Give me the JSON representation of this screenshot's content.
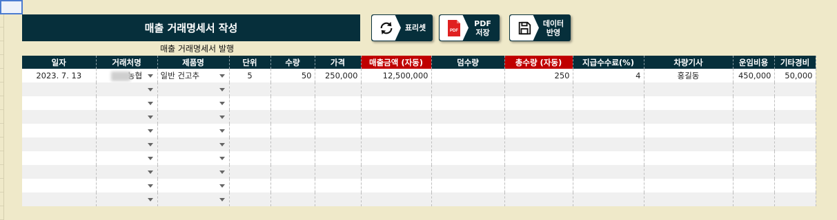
{
  "title": "매출 거래명세서 작성",
  "subtitle": "매출 거래명세서 발행",
  "buttons": {
    "refresh": {
      "label": "표리셋",
      "icon": "refresh-icon"
    },
    "pdf": {
      "label": "PDF\n저장",
      "icon": "pdf-icon",
      "icon_text": "PDF"
    },
    "save": {
      "label": "데이터\n반영",
      "icon": "save-icon"
    }
  },
  "columns": [
    "일자",
    "거래처명",
    "제품명",
    "단위",
    "수량",
    "가격",
    "매출금액 (자동)",
    "덤수량",
    "총수량 (자동)",
    "지급수수료(%)",
    "차량기사",
    "운임비용",
    "기타경비"
  ],
  "rows": [
    {
      "date": "2023. 7. 13",
      "client": "농협",
      "product": "일반 건고추",
      "unit": "5",
      "qty": "50",
      "price": "250,000",
      "sales": "12,500,000",
      "bonus": "",
      "total_qty": "250",
      "fee": "4",
      "driver": "홍길동",
      "freight": "450,000",
      "other": "50,000"
    },
    {
      "date": "",
      "client": "",
      "product": "",
      "unit": "",
      "qty": "",
      "price": "",
      "sales": "",
      "bonus": "",
      "total_qty": "",
      "fee": "",
      "driver": "",
      "freight": "",
      "other": ""
    },
    {
      "date": "",
      "client": "",
      "product": "",
      "unit": "",
      "qty": "",
      "price": "",
      "sales": "",
      "bonus": "",
      "total_qty": "",
      "fee": "",
      "driver": "",
      "freight": "",
      "other": ""
    },
    {
      "date": "",
      "client": "",
      "product": "",
      "unit": "",
      "qty": "",
      "price": "",
      "sales": "",
      "bonus": "",
      "total_qty": "",
      "fee": "",
      "driver": "",
      "freight": "",
      "other": ""
    },
    {
      "date": "",
      "client": "",
      "product": "",
      "unit": "",
      "qty": "",
      "price": "",
      "sales": "",
      "bonus": "",
      "total_qty": "",
      "fee": "",
      "driver": "",
      "freight": "",
      "other": ""
    },
    {
      "date": "",
      "client": "",
      "product": "",
      "unit": "",
      "qty": "",
      "price": "",
      "sales": "",
      "bonus": "",
      "total_qty": "",
      "fee": "",
      "driver": "",
      "freight": "",
      "other": ""
    },
    {
      "date": "",
      "client": "",
      "product": "",
      "unit": "",
      "qty": "",
      "price": "",
      "sales": "",
      "bonus": "",
      "total_qty": "",
      "fee": "",
      "driver": "",
      "freight": "",
      "other": ""
    },
    {
      "date": "",
      "client": "",
      "product": "",
      "unit": "",
      "qty": "",
      "price": "",
      "sales": "",
      "bonus": "",
      "total_qty": "",
      "fee": "",
      "driver": "",
      "freight": "",
      "other": ""
    },
    {
      "date": "",
      "client": "",
      "product": "",
      "unit": "",
      "qty": "",
      "price": "",
      "sales": "",
      "bonus": "",
      "total_qty": "",
      "fee": "",
      "driver": "",
      "freight": "",
      "other": ""
    },
    {
      "date": "",
      "client": "",
      "product": "",
      "unit": "",
      "qty": "",
      "price": "",
      "sales": "",
      "bonus": "",
      "total_qty": "",
      "fee": "",
      "driver": "",
      "freight": "",
      "other": ""
    }
  ],
  "colors": {
    "header": "#062f3b",
    "auto_header": "#c00000",
    "background": "#efe9c9"
  }
}
